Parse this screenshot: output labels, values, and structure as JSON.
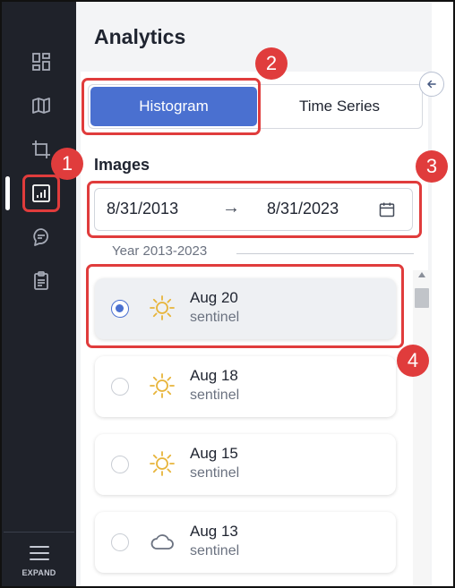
{
  "sidebar": {
    "items": [
      {
        "icon": "dashboard-icon"
      },
      {
        "icon": "map-icon"
      },
      {
        "icon": "crop-icon"
      },
      {
        "icon": "analytics-icon",
        "active": true
      },
      {
        "icon": "chat-location-icon"
      },
      {
        "icon": "clipboard-icon"
      }
    ],
    "expand_label": "EXPAND"
  },
  "header": {
    "title": "Analytics"
  },
  "tabs": [
    {
      "label": "Histogram",
      "active": true
    },
    {
      "label": "Time Series",
      "active": false
    }
  ],
  "images": {
    "title": "Images",
    "date_start": "8/31/2013",
    "arrow": "→",
    "date_end": "8/31/2023",
    "year_label": "Year 2013-2023",
    "list": [
      {
        "date": "Aug 20",
        "source": "sentinel",
        "weather": "sun-icon",
        "selected": true
      },
      {
        "date": "Aug 18",
        "source": "sentinel",
        "weather": "sun-icon",
        "selected": false
      },
      {
        "date": "Aug 15",
        "source": "sentinel",
        "weather": "sun-icon",
        "selected": false
      },
      {
        "date": "Aug 13",
        "source": "sentinel",
        "weather": "cloud-icon",
        "selected": false
      }
    ]
  },
  "annotations": [
    "1",
    "2",
    "3",
    "4"
  ],
  "colors": {
    "sidebar_bg": "#1f222a",
    "accent": "#4a70d0",
    "annotation": "#e03c3c",
    "sun": "#e7b43a"
  }
}
